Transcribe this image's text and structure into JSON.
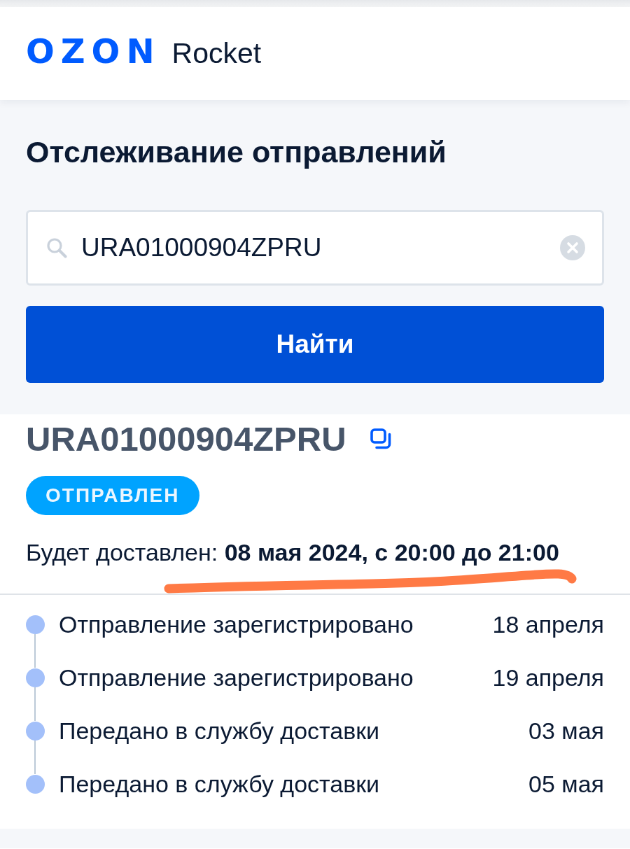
{
  "header": {
    "logo": {
      "brand": "OZON",
      "product": "Rocket"
    }
  },
  "tracking_form": {
    "title": "Отслеживание отправлений",
    "search": {
      "value": "URA01000904ZPRU"
    },
    "submit_button": "Найти"
  },
  "shipment": {
    "number": "URA01000904ZPRU",
    "status": "ОТПРАВЛЕН",
    "delivery": "Будет доставлен: **08 мая 2024, с 20:00 до 21:00**",
    "annotation": {
      "kind": "underline"
    }
  },
  "events": [
    {
      "title": "Отправление зарегистрировано",
      "date": "18 апреля"
    },
    {
      "title": "Отправление зарегистрировано",
      "date": "19 апреля"
    },
    {
      "title": "Передано в службу доставки",
      "date": "03 мая"
    },
    {
      "title": "Передано в службу доставки",
      "date": "05 мая"
    }
  ]
}
